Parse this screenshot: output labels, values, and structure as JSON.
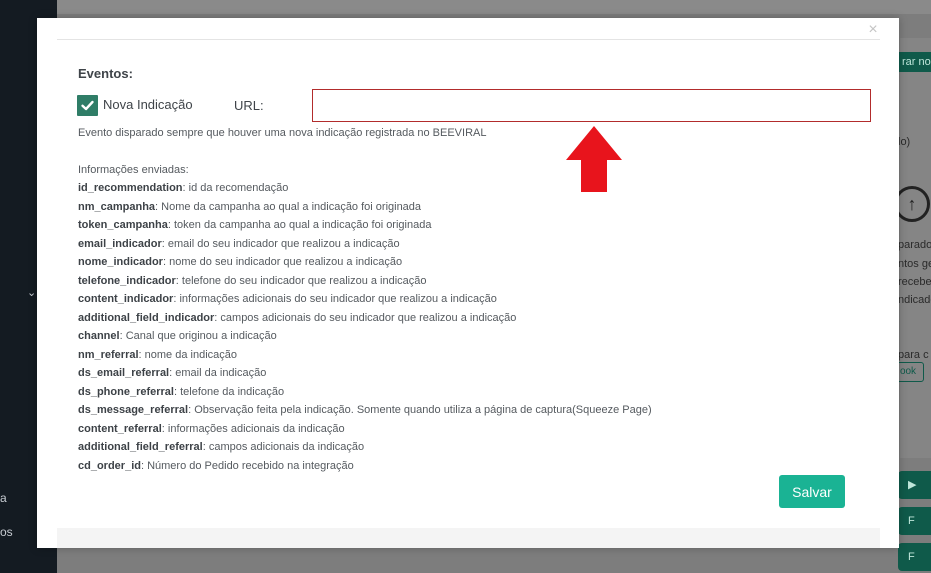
{
  "background": {
    "sidebar_fragments": [
      "a",
      "os"
    ],
    "right_fragments": {
      "button": "rar no",
      "lines": [
        "lo)",
        "parado",
        "ntos ge",
        "recebe",
        "ndicado",
        "para c"
      ],
      "outline_button": "ook",
      "pill_labels": [
        "",
        "F",
        "F"
      ]
    }
  },
  "modal": {
    "close_label": "×",
    "events_title": "Eventos:",
    "checkbox_label": "Nova Indicação",
    "checkbox_checked": true,
    "url_label": "URL:",
    "url_value": "",
    "event_description": "Evento disparado sempre que houver uma nova indicação registrada no BEEVIRAL",
    "info_title": "Informações enviadas:",
    "fields": [
      {
        "key": "id_recommendation",
        "desc": ": id da recomendação"
      },
      {
        "key": "nm_campanha",
        "desc": ": Nome da campanha ao qual a indicação foi originada"
      },
      {
        "key": "token_campanha",
        "desc": ": token da campanha ao qual a indicação foi originada"
      },
      {
        "key": "email_indicador",
        "desc": ": email do seu indicador que realizou a indicação"
      },
      {
        "key": "nome_indicador",
        "desc": ": nome do seu indicador que realizou a indicação"
      },
      {
        "key": "telefone_indicador",
        "desc": ": telefone do seu indicador que realizou a indicação"
      },
      {
        "key": "content_indicador",
        "desc": ": informações adicionais do seu indicador que realizou a indicação"
      },
      {
        "key": "additional_field_indicador",
        "desc": ": campos adicionais do seu indicador que realizou a indicação"
      },
      {
        "key": "channel",
        "desc": ": Canal que originou a indicação"
      },
      {
        "key": "nm_referral",
        "desc": ": nome da indicação"
      },
      {
        "key": "ds_email_referral",
        "desc": ": email da indicação"
      },
      {
        "key": "ds_phone_referral",
        "desc": ": telefone da indicação"
      },
      {
        "key": "ds_message_referral",
        "desc": ": Observação feita pela indicação. Somente quando utiliza a página de captura(Squeeze Page)"
      },
      {
        "key": "content_referral",
        "desc": ": informações adicionais da indicação"
      },
      {
        "key": "additional_field_referral",
        "desc": ": campos adicionais da indicação"
      },
      {
        "key": "cd_order_id",
        "desc": ": Número do Pedido recebido na integração"
      }
    ],
    "save_label": "Salvar"
  },
  "colors": {
    "accent": "#1ab394",
    "checkbox": "#2f7d67",
    "input_border_error": "#b22c2c",
    "arrow": "#e8141c"
  },
  "icons": {
    "close": "close-icon",
    "check": "check-icon",
    "annotation_arrow": "arrow-up-icon",
    "upload": "upload-icon",
    "chevron": "chevron-down-icon"
  }
}
